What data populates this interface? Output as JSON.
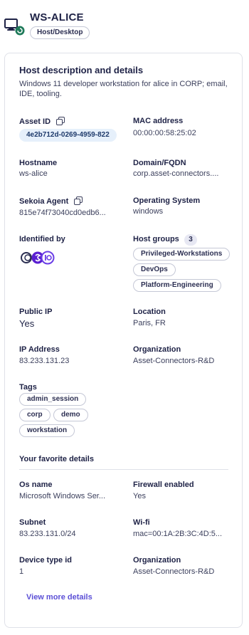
{
  "header": {
    "title": "WS-ALICE",
    "type_badge": "Host/Desktop"
  },
  "card": {
    "title": "Host description and details",
    "description": "Windows 11 developer workstation for alice in CORP; email, IDE, tooling."
  },
  "fields": {
    "asset_id": {
      "label": "Asset ID",
      "value": "4e2b712d-0269-4959-822"
    },
    "mac_address": {
      "label": "MAC address",
      "value": "00:00:00:58:25:02"
    },
    "hostname": {
      "label": "Hostname",
      "value": "ws-alice"
    },
    "domain": {
      "label": "Domain/FQDN",
      "value": "corp.asset-connectors...."
    },
    "sekoia_agent": {
      "label": "Sekoia Agent",
      "value": "815e74f73040cd0edb6..."
    },
    "os": {
      "label": "Operating System",
      "value": "windows"
    },
    "identified_by": {
      "label": "Identified by"
    },
    "host_groups": {
      "label": "Host groups",
      "count": "3",
      "items": [
        "Privileged-Workstations",
        "DevOps",
        "Platform-Engineering"
      ]
    },
    "public_ip": {
      "label": "Public IP",
      "value": "Yes"
    },
    "location": {
      "label": "Location",
      "value": "Paris, FR"
    },
    "ip_address": {
      "label": "IP Address",
      "value": "83.233.131.23"
    },
    "organization": {
      "label": "Organization",
      "value": "Asset-Connectors-R&D"
    },
    "tags": {
      "label": "Tags",
      "items": [
        "admin_session",
        "corp",
        "demo",
        "workstation"
      ]
    }
  },
  "favorites": {
    "title": "Your favorite details",
    "os_name": {
      "label": "Os name",
      "value": "Microsoft Windows Ser..."
    },
    "firewall": {
      "label": "Firewall enabled",
      "value": "Yes"
    },
    "subnet": {
      "label": "Subnet",
      "value": "83.233.131.0/24"
    },
    "wifi": {
      "label": "Wi-fi",
      "value": "mac=00:1A:2B:3C:4D:5..."
    },
    "device_type": {
      "label": "Device type id",
      "value": "1"
    },
    "organization": {
      "label": "Organization",
      "value": "Asset-Connectors-R&D"
    }
  },
  "view_more": "View more details",
  "colors": {
    "text": "#1e2246",
    "accent": "#5b4fd6",
    "chip_bg": "#e6f0fb",
    "status_green": "#1f7a5a"
  },
  "icons": {
    "host": "desktop-host-icon",
    "copy": "copy-icon",
    "identified_by": "connector-logos-icon"
  }
}
